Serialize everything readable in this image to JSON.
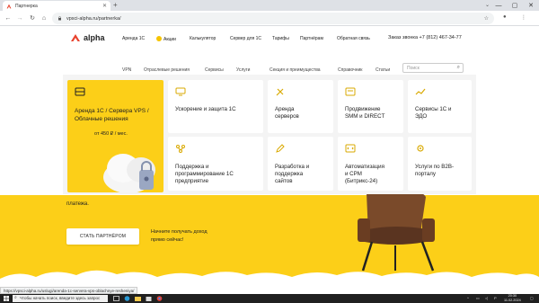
{
  "browser": {
    "tab_title": "Партнерка",
    "address": "vpsci-alpha.ru/partnerka/",
    "status_url": "https://vpsci-alpha.ru/uslugi/arenda-1c-servera-vps-oblachnye-resheniya/"
  },
  "site": {
    "logo_text": "alpha",
    "nav": [
      "Аренда 1С",
      "Акции",
      "Калькулятор",
      "Сервер для 1С",
      "Тарифы",
      "Партнёрам",
      "Обратная связь"
    ],
    "phone": "Заказ звонка +7 (812) 467-34-77",
    "subnav": [
      "VPN",
      "Отраслевые решения",
      "Сервисы",
      "Услуги",
      "Секция и преимущества",
      "Справочник",
      "Статьи"
    ],
    "search_placeholder": "Поиск"
  },
  "mega_menu": {
    "featured": {
      "title_line1": "Аренда 1С / Сервера VPS /",
      "title_line2": "Облачные решения",
      "price": "от 450 ₽ / мес."
    },
    "cards": [
      {
        "icon": "monitor-icon",
        "lines": [
          "Ускорение и защита 1С"
        ]
      },
      {
        "icon": "tools-icon",
        "lines": [
          "Аренда",
          "серверов"
        ]
      },
      {
        "icon": "megaphone-icon",
        "lines": [
          "Продвижение",
          "SMM и DIRECT"
        ]
      },
      {
        "icon": "chart-icon",
        "lines": [
          "Сервисы 1С и",
          "ЭДО"
        ]
      },
      {
        "icon": "network-icon",
        "lines": [
          "Поддержка и",
          "программирование 1С",
          "предприятие"
        ]
      },
      {
        "icon": "pencil-icon",
        "lines": [
          "Разработка и",
          "поддержка",
          "сайтов"
        ]
      },
      {
        "icon": "code-icon",
        "lines": [
          "Автоматизация",
          "и CPM",
          "(Битрикс-24)"
        ]
      },
      {
        "icon": "gear-icon",
        "lines": [
          "Услуги по B2B-",
          "порталу"
        ]
      }
    ]
  },
  "hero": {
    "text": "платежа.",
    "cta": "СТАТЬ ПАРТНЁРОМ",
    "note_line1": "Начните получать доход",
    "note_line2": "прямо сейчас!"
  },
  "taskbar": {
    "search_placeholder": "Чтобы начать поиск, введите здесь запрос",
    "time": "20:30",
    "date": "11.02.2024"
  },
  "colors": {
    "accent": "#fccf18",
    "brand_red": "#e8412c"
  }
}
